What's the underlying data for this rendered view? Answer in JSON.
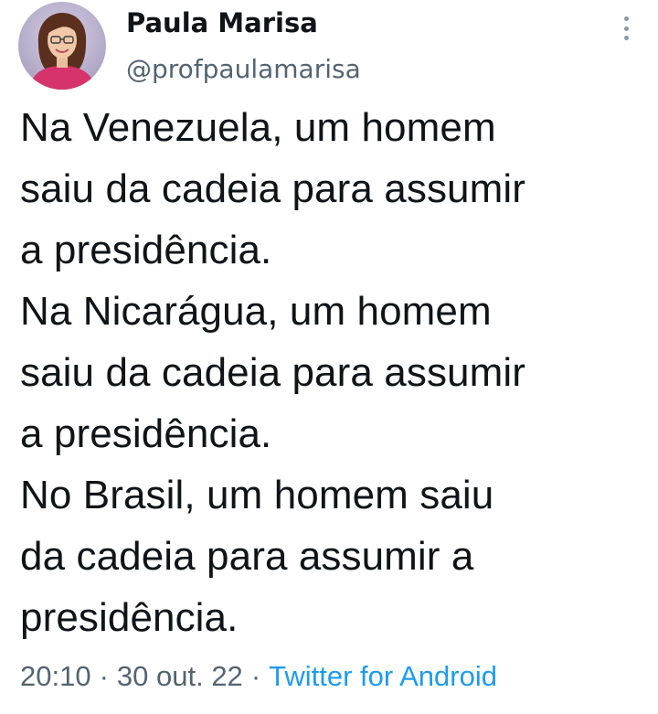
{
  "tweet": {
    "author": {
      "name": "Paula Marisa",
      "handle": "@profpaulamarisa"
    },
    "text_lines": [
      "Na Venezuela, um homem",
      "saiu da cadeia para assumir",
      "a presidência.",
      "Na Nicarágua, um homem",
      "saiu da cadeia para assumir",
      "a presidência.",
      "No Brasil, um homem saiu",
      "da cadeia para assumir a",
      "presidência."
    ],
    "meta": {
      "time": "20:10",
      "separator": "·",
      "date": "30 out. 22",
      "source": "Twitter for Android"
    },
    "icons": {
      "more": "more-vertical-icon"
    },
    "colors": {
      "text": "#0f1419",
      "secondary": "#536471",
      "link": "#1d9bf0"
    }
  }
}
